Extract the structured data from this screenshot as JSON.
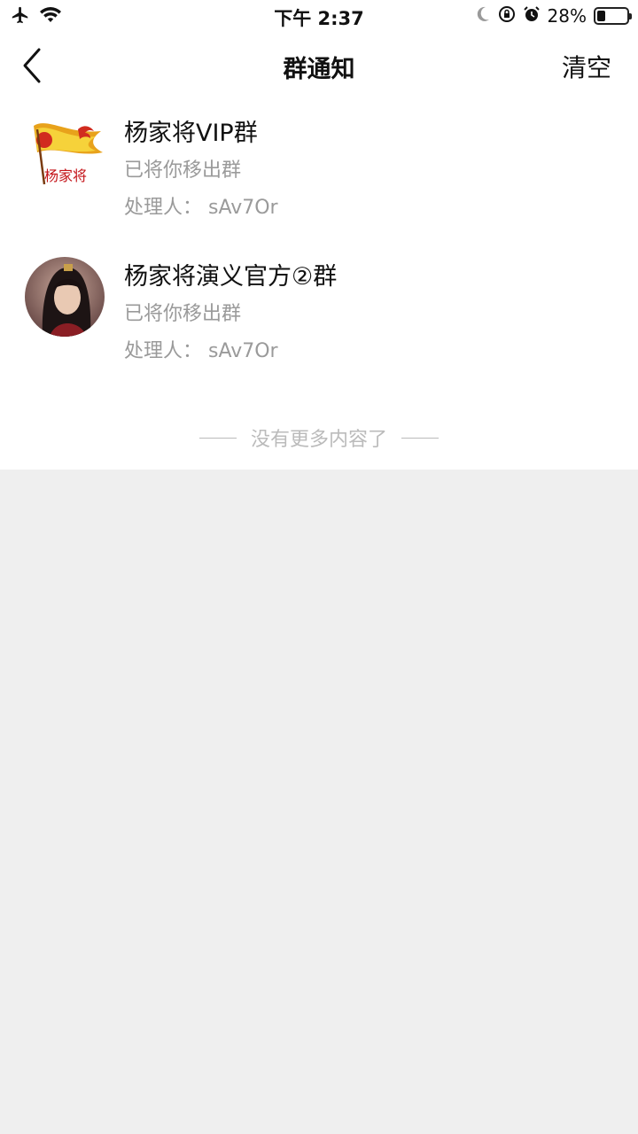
{
  "status_bar": {
    "time": "下午 2:37",
    "battery_percent_text": "28%",
    "battery_level": 0.28,
    "icons": [
      "airplane-icon",
      "wifi-icon",
      "moon-icon",
      "orientation-lock-icon",
      "alarm-icon",
      "battery-icon"
    ]
  },
  "nav": {
    "title": "群通知",
    "clear_label": "清空",
    "back_icon": "chevron-left-icon"
  },
  "notices": [
    {
      "group_name": "杨家将VIP群",
      "status": "已将你移出群",
      "handler": "处理人：  sAv7Or",
      "avatar_text": "杨家将"
    },
    {
      "group_name": "杨家将演义官方②群",
      "status": "已将你移出群",
      "handler": "处理人：  sAv7Or"
    }
  ],
  "end_text": "没有更多内容了",
  "colors": {
    "background": "#efefef",
    "panel": "#ffffff",
    "secondary_text": "#9a9a9a",
    "end_text": "#bbbbbb"
  }
}
